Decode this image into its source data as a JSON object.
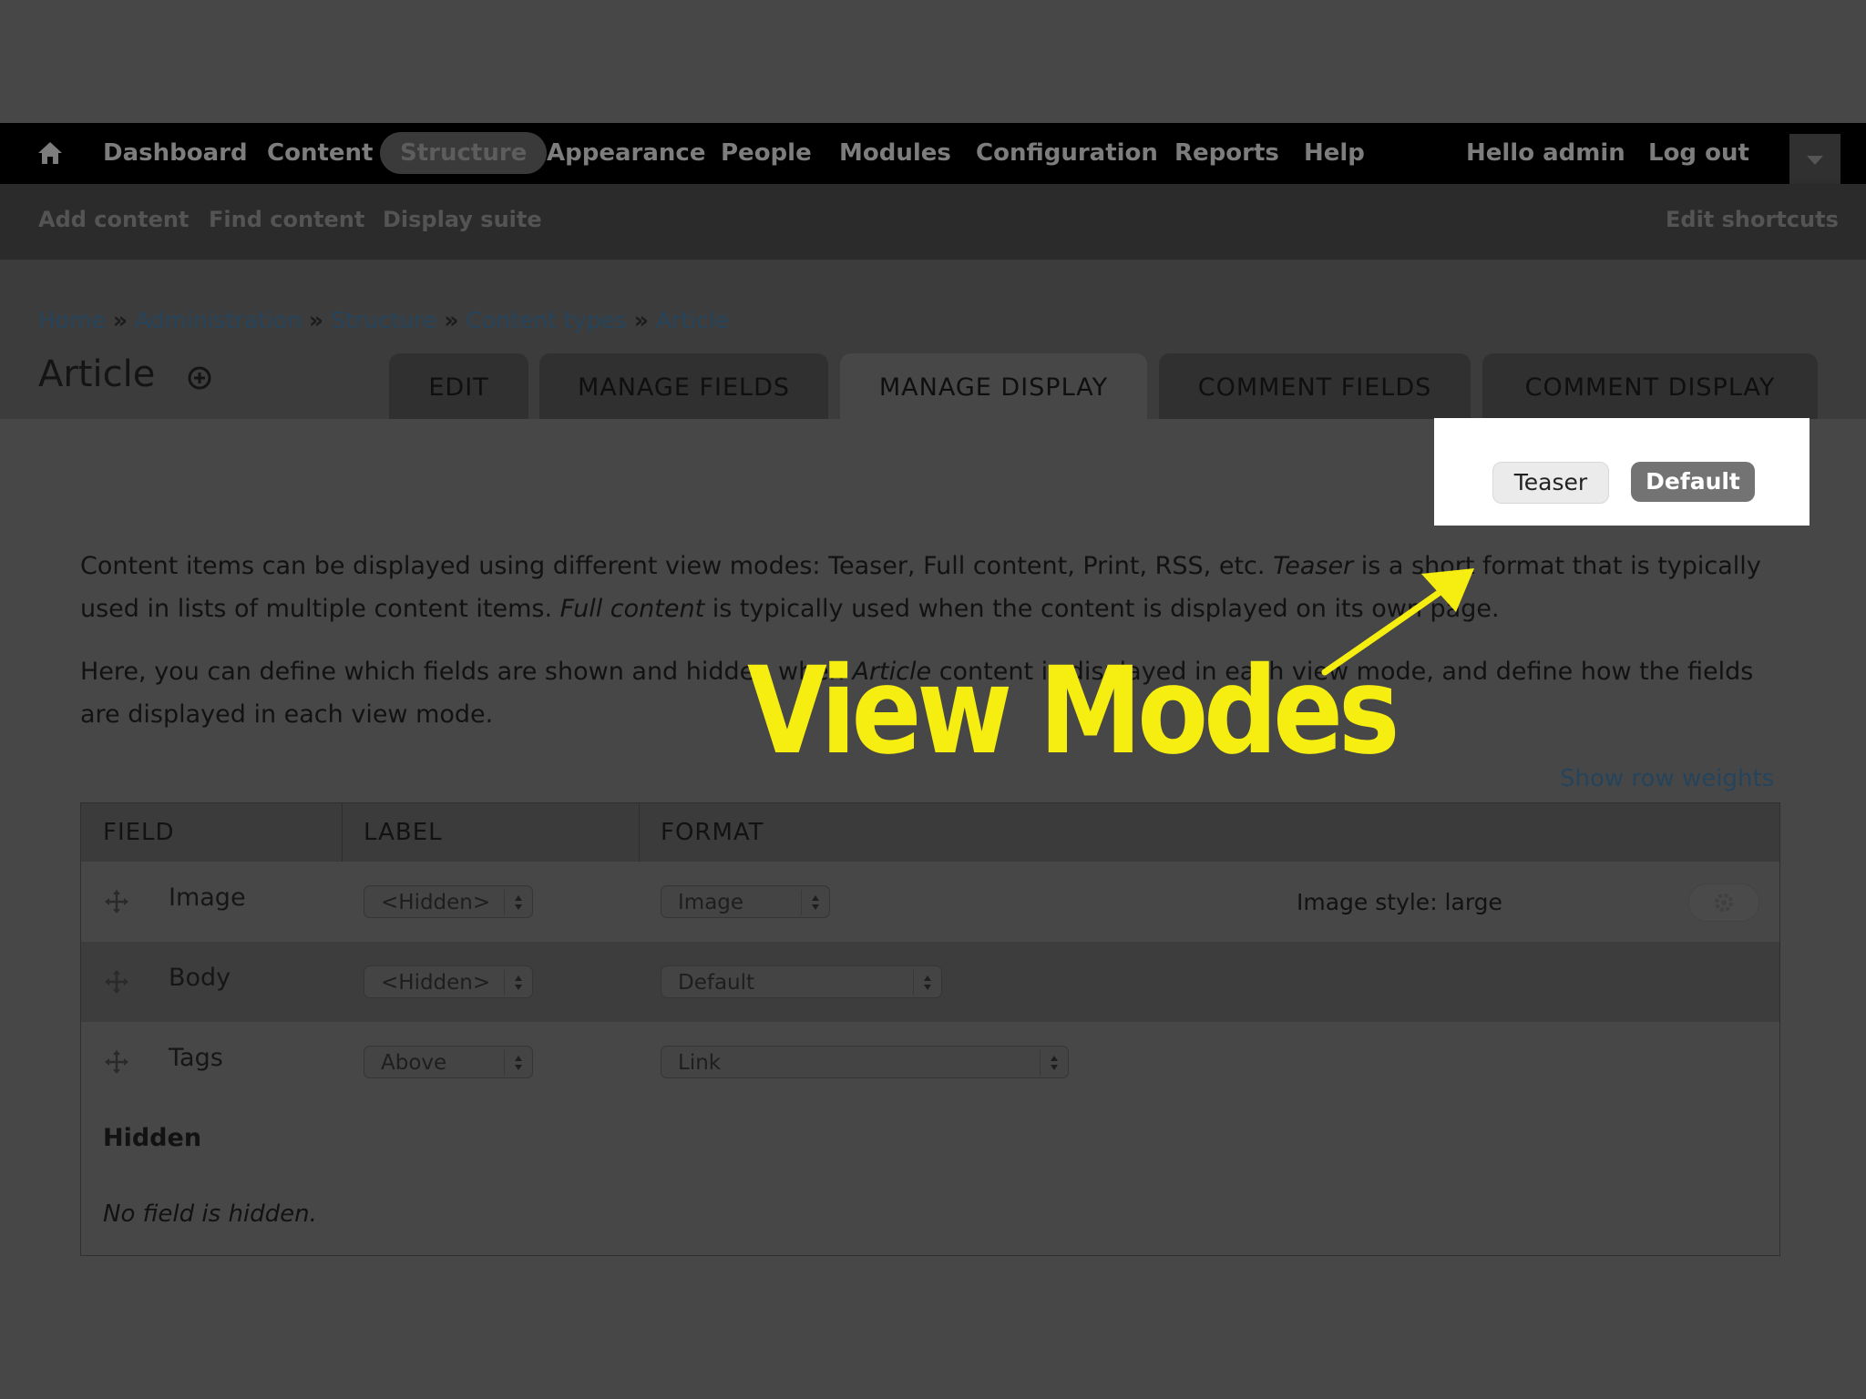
{
  "toolbar": {
    "items": [
      "Dashboard",
      "Content",
      "Structure",
      "Appearance",
      "People",
      "Modules",
      "Configuration",
      "Reports",
      "Help"
    ],
    "greeting": "Hello admin",
    "logout": "Log out"
  },
  "shortcuts": {
    "items": [
      "Add content",
      "Find content",
      "Display suite"
    ],
    "edit": "Edit shortcuts"
  },
  "breadcrumb": [
    "Home",
    "Administration",
    "Structure",
    "Content types",
    "Article"
  ],
  "breadcrumb_separator": "»",
  "page_title": "Article",
  "tabs": [
    "EDIT",
    "MANAGE FIELDS",
    "MANAGE DISPLAY",
    "COMMENT FIELDS",
    "COMMENT DISPLAY"
  ],
  "active_tab": "MANAGE DISPLAY",
  "view_modes": {
    "teaser": "Teaser",
    "default": "Default",
    "selected": "Default"
  },
  "description": {
    "p1_a": "Content items can be displayed using different view modes: Teaser, Full content, Print, RSS, etc. ",
    "p1_teaser": "Teaser",
    "p1_b": " is a short format that is typically used in lists of multiple content items. ",
    "p1_full": "Full content",
    "p1_c": " is typically used when the content is displayed on its own page.",
    "p2_a": "Here, you can define which fields are shown and hidden when ",
    "p2_article": "Article",
    "p2_b": " content is displayed in each view mode, and define how the fields are displayed in each view mode."
  },
  "annotation": {
    "label": "View Modes",
    "color": "#f6ee10"
  },
  "table": {
    "show_row_weights": "Show row weights",
    "headers": {
      "field": "FIELD",
      "label": "LABEL",
      "format": "FORMAT"
    },
    "rows": [
      {
        "field": "Image",
        "label": "<Hidden>",
        "format": "Image",
        "summary": "Image style: large"
      },
      {
        "field": "Body",
        "label": "<Hidden>",
        "format": "Default"
      },
      {
        "field": "Tags",
        "label": "Above",
        "format": "Link"
      }
    ],
    "hidden_heading": "Hidden",
    "no_hidden": "No field is hidden."
  },
  "icons": [
    "home-icon",
    "chevron-down-icon",
    "add-circle-icon",
    "drag-handle-icon",
    "gear-icon",
    "arrow-icon"
  ]
}
